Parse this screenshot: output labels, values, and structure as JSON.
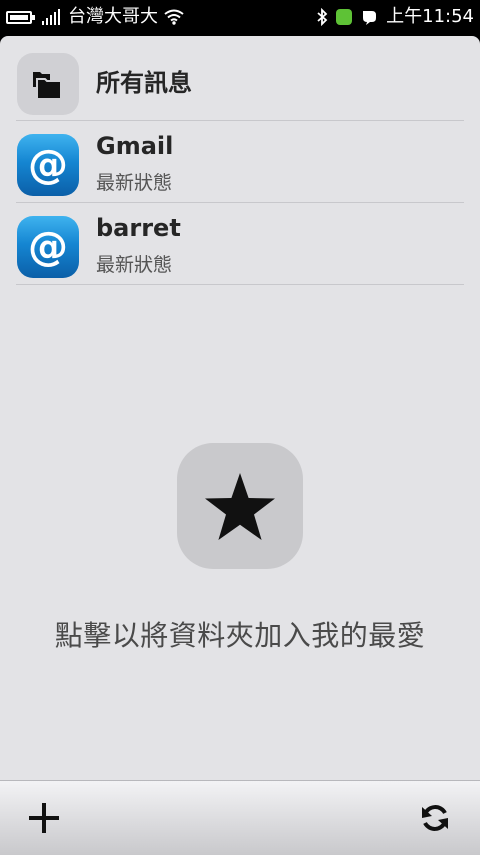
{
  "status_bar": {
    "carrier": "台灣大哥大",
    "time": "上午11:54",
    "icons": [
      "battery-icon",
      "signal-icon",
      "wifi-icon",
      "bluetooth-icon",
      "green-status-icon",
      "chat-icon"
    ]
  },
  "accounts": [
    {
      "title": "所有訊息",
      "icon": "folders-icon"
    },
    {
      "title": "Gmail",
      "subtitle": "最新狀態",
      "icon": "at-icon"
    },
    {
      "title": "barret",
      "subtitle": "最新狀態",
      "icon": "at-icon"
    }
  ],
  "favorites": {
    "hint": "點擊以將資料夾加入我的最愛",
    "icon": "star-icon"
  },
  "toolbar": {
    "icons": [
      "add-icon",
      "refresh-icon"
    ]
  }
}
